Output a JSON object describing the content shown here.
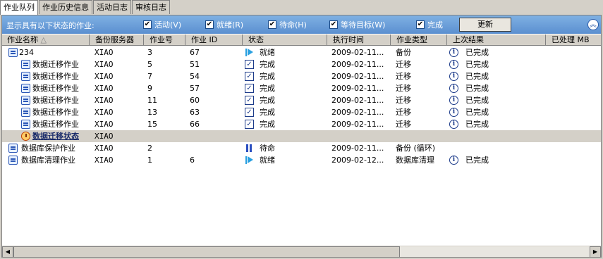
{
  "tabs": [
    "作业队列",
    "作业历史信息",
    "活动日志",
    "审核日志"
  ],
  "filter": {
    "title": "显示具有以下状态的作业:",
    "items": [
      {
        "label": "活动(V)",
        "checked": true
      },
      {
        "label": "就绪(R)",
        "checked": true
      },
      {
        "label": "待命(H)",
        "checked": true
      },
      {
        "label": "等待目标(W)",
        "checked": true
      },
      {
        "label": "完成",
        "checked": true
      }
    ],
    "refresh_label": "更新",
    "collapse_icon": "chevron-double-up-icon"
  },
  "columns": [
    "作业名称",
    "备份服务器",
    "作业号",
    "作业 ID",
    "状态",
    "执行时间",
    "作业类型",
    "上次结果",
    "已处理 MB"
  ],
  "rows": [
    {
      "name": "234",
      "icon": "job-icon",
      "server": "XIAO",
      "job_no": "3",
      "job_id": "67",
      "status_icon": "play-icon",
      "status": "就绪",
      "time": "2009-02-11...",
      "type": "备份",
      "result_icon": "info-icon",
      "result": "已完成",
      "indent": 0
    },
    {
      "name": "数据迁移作业",
      "icon": "job-icon",
      "server": "XIAO",
      "job_no": "5",
      "job_id": "51",
      "status_icon": "check-icon",
      "status": "完成",
      "time": "2009-02-11...",
      "type": "迁移",
      "result_icon": "info-icon",
      "result": "已完成",
      "indent": 1
    },
    {
      "name": "数据迁移作业",
      "icon": "job-icon",
      "server": "XIAO",
      "job_no": "7",
      "job_id": "54",
      "status_icon": "check-icon",
      "status": "完成",
      "time": "2009-02-11...",
      "type": "迁移",
      "result_icon": "info-icon",
      "result": "已完成",
      "indent": 1
    },
    {
      "name": "数据迁移作业",
      "icon": "job-icon",
      "server": "XIAO",
      "job_no": "9",
      "job_id": "57",
      "status_icon": "check-icon",
      "status": "完成",
      "time": "2009-02-11...",
      "type": "迁移",
      "result_icon": "info-icon",
      "result": "已完成",
      "indent": 1
    },
    {
      "name": "数据迁移作业",
      "icon": "job-icon",
      "server": "XIAO",
      "job_no": "11",
      "job_id": "60",
      "status_icon": "check-icon",
      "status": "完成",
      "time": "2009-02-11...",
      "type": "迁移",
      "result_icon": "info-icon",
      "result": "已完成",
      "indent": 1
    },
    {
      "name": "数据迁移作业",
      "icon": "job-icon",
      "server": "XIAO",
      "job_no": "13",
      "job_id": "63",
      "status_icon": "check-icon",
      "status": "完成",
      "time": "2009-02-11...",
      "type": "迁移",
      "result_icon": "info-icon",
      "result": "已完成",
      "indent": 1
    },
    {
      "name": "数据迁移作业",
      "icon": "job-icon",
      "server": "XIAO",
      "job_no": "15",
      "job_id": "66",
      "status_icon": "check-icon",
      "status": "完成",
      "time": "2009-02-11...",
      "type": "迁移",
      "result_icon": "info-icon",
      "result": "已完成",
      "indent": 1
    },
    {
      "name": "数据迁移状态",
      "icon": "clock-icon",
      "server": "XIAO",
      "job_no": "",
      "job_id": "",
      "status_icon": "",
      "status": "",
      "time": "",
      "type": "",
      "result_icon": "",
      "result": "",
      "indent": 1,
      "selected": true,
      "bold": true
    },
    {
      "name": "数据库保护作业",
      "icon": "job-icon",
      "server": "XIAO",
      "job_no": "2",
      "job_id": "",
      "status_icon": "pause-icon",
      "status": "待命",
      "time": "2009-02-11...",
      "type": "备份 (循环)",
      "result_icon": "",
      "result": "",
      "indent": 0
    },
    {
      "name": "数据库清理作业",
      "icon": "job-icon",
      "server": "XIAO",
      "job_no": "1",
      "job_id": "6",
      "status_icon": "play-icon",
      "status": "就绪",
      "time": "2009-02-12...",
      "type": "数据库清理",
      "result_icon": "info-icon",
      "result": "已完成",
      "indent": 0
    }
  ]
}
